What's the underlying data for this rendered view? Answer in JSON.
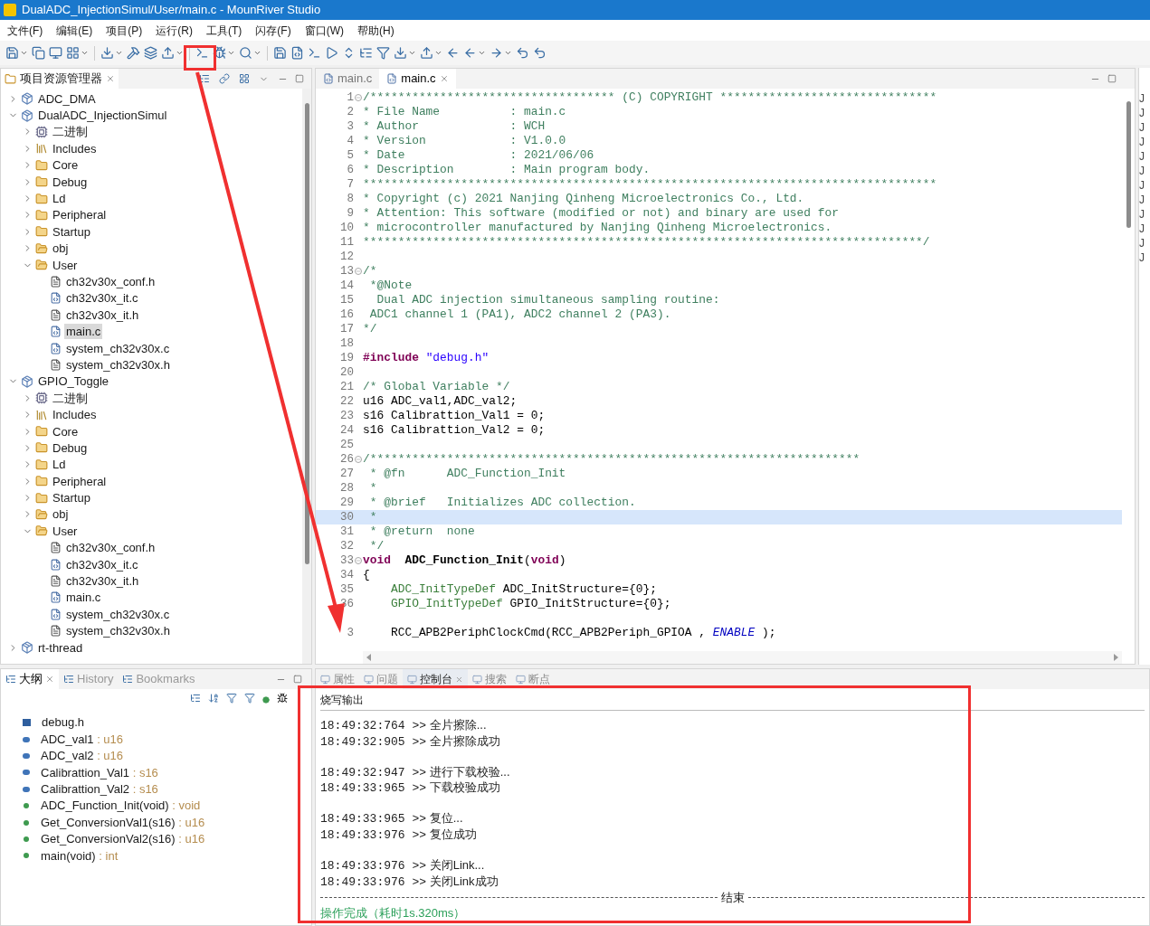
{
  "window": {
    "title": "DualADC_InjectionSimul/User/main.c - MounRiver Studio"
  },
  "menu": [
    "文件(F)",
    "编辑(E)",
    "项目(P)",
    "运行(R)",
    "工具(T)",
    "闪存(F)",
    "窗口(W)",
    "帮助(H)"
  ],
  "project_explorer": {
    "title": "项目资源管理器",
    "tree": [
      {
        "label": "ADC_DMA",
        "kind": "project",
        "expanded": false,
        "selected": false
      },
      {
        "label": "DualADC_InjectionSimul",
        "kind": "project",
        "expanded": true,
        "selected": false,
        "children": [
          {
            "label": "二进制",
            "kind": "binaries",
            "expanded": false,
            "selected": false
          },
          {
            "label": "Includes",
            "kind": "includes",
            "expanded": false,
            "selected": false
          },
          {
            "label": "Core",
            "kind": "source",
            "expanded": false,
            "selected": false
          },
          {
            "label": "Debug",
            "kind": "source",
            "expanded": false,
            "selected": false
          },
          {
            "label": "Ld",
            "kind": "source",
            "expanded": false,
            "selected": false
          },
          {
            "label": "Peripheral",
            "kind": "source",
            "expanded": false,
            "selected": false
          },
          {
            "label": "Startup",
            "kind": "source",
            "expanded": false,
            "selected": false
          },
          {
            "label": "obj",
            "kind": "folder",
            "expanded": false,
            "selected": false
          },
          {
            "label": "User",
            "kind": "folder",
            "expanded": true,
            "selected": false,
            "children": [
              {
                "label": "ch32v30x_conf.h",
                "kind": "h",
                "selected": false
              },
              {
                "label": "ch32v30x_it.c",
                "kind": "c",
                "selected": false
              },
              {
                "label": "ch32v30x_it.h",
                "kind": "h",
                "selected": false
              },
              {
                "label": "main.c",
                "kind": "c",
                "selected": true
              },
              {
                "label": "system_ch32v30x.c",
                "kind": "c",
                "selected": false
              },
              {
                "label": "system_ch32v30x.h",
                "kind": "h",
                "selected": false
              }
            ]
          }
        ]
      },
      {
        "label": "GPIO_Toggle",
        "kind": "project",
        "expanded": true,
        "selected": false,
        "children": [
          {
            "label": "二进制",
            "kind": "binaries",
            "expanded": false,
            "selected": false
          },
          {
            "label": "Includes",
            "kind": "includes",
            "expanded": false,
            "selected": false
          },
          {
            "label": "Core",
            "kind": "source",
            "expanded": false,
            "selected": false
          },
          {
            "label": "Debug",
            "kind": "source",
            "expanded": false,
            "selected": false
          },
          {
            "label": "Ld",
            "kind": "source",
            "expanded": false,
            "selected": false
          },
          {
            "label": "Peripheral",
            "kind": "source",
            "expanded": false,
            "selected": false
          },
          {
            "label": "Startup",
            "kind": "source",
            "expanded": false,
            "selected": false
          },
          {
            "label": "obj",
            "kind": "folder",
            "expanded": false,
            "selected": false
          },
          {
            "label": "User",
            "kind": "folder",
            "expanded": true,
            "selected": false,
            "children": [
              {
                "label": "ch32v30x_conf.h",
                "kind": "h",
                "selected": false
              },
              {
                "label": "ch32v30x_it.c",
                "kind": "c",
                "selected": false
              },
              {
                "label": "ch32v30x_it.h",
                "kind": "h",
                "selected": false
              },
              {
                "label": "main.c",
                "kind": "c",
                "selected": false
              },
              {
                "label": "system_ch32v30x.c",
                "kind": "c",
                "selected": false
              },
              {
                "label": "system_ch32v30x.h",
                "kind": "h",
                "selected": false
              }
            ]
          }
        ]
      },
      {
        "label": "rt-thread",
        "kind": "project",
        "expanded": false,
        "selected": false
      }
    ]
  },
  "editor": {
    "tabs": [
      {
        "label": "main.c",
        "selected": false
      },
      {
        "label": "main.c",
        "selected": true
      }
    ],
    "lines": [
      {
        "n": "1",
        "fold": true,
        "current": false,
        "segs": [
          {
            "kind": "comment",
            "s": "/*********************************** (C) COPYRIGHT *******************************"
          }
        ]
      },
      {
        "n": "2",
        "fold": false,
        "current": false,
        "segs": [
          {
            "kind": "comment",
            "s": "* File Name          : main.c"
          }
        ]
      },
      {
        "n": "3",
        "fold": false,
        "current": false,
        "segs": [
          {
            "kind": "comment",
            "s": "* Author             : WCH"
          }
        ]
      },
      {
        "n": "4",
        "fold": false,
        "current": false,
        "segs": [
          {
            "kind": "comment",
            "s": "* Version            : V1.0.0"
          }
        ]
      },
      {
        "n": "5",
        "fold": false,
        "current": false,
        "segs": [
          {
            "kind": "comment",
            "s": "* Date               : 2021/06/06"
          }
        ]
      },
      {
        "n": "6",
        "fold": false,
        "current": false,
        "segs": [
          {
            "kind": "comment",
            "s": "* Description        : Main program body."
          }
        ]
      },
      {
        "n": "7",
        "fold": false,
        "current": false,
        "segs": [
          {
            "kind": "comment",
            "s": "**********************************************************************************"
          }
        ]
      },
      {
        "n": "8",
        "fold": false,
        "current": false,
        "segs": [
          {
            "kind": "comment",
            "s": "* Copyright (c) 2021 Nanjing Qinheng Microelectronics Co., Ltd."
          }
        ]
      },
      {
        "n": "9",
        "fold": false,
        "current": false,
        "segs": [
          {
            "kind": "comment",
            "s": "* Attention: This software (modified or not) and binary are used for"
          }
        ]
      },
      {
        "n": "10",
        "fold": false,
        "current": false,
        "segs": [
          {
            "kind": "comment",
            "s": "* microcontroller manufactured by Nanjing Qinheng Microelectronics."
          }
        ]
      },
      {
        "n": "11",
        "fold": false,
        "current": false,
        "segs": [
          {
            "kind": "comment",
            "s": "********************************************************************************/"
          }
        ]
      },
      {
        "n": "12",
        "fold": false,
        "current": false
      },
      {
        "n": "13",
        "fold": true,
        "current": false,
        "segs": [
          {
            "kind": "comment",
            "s": "/*"
          }
        ]
      },
      {
        "n": "14",
        "fold": false,
        "current": false,
        "segs": [
          {
            "kind": "comment",
            "s": " *@Note"
          }
        ]
      },
      {
        "n": "15",
        "fold": false,
        "current": false,
        "segs": [
          {
            "kind": "comment",
            "s": "  Dual ADC injection simultaneous sampling routine:"
          }
        ]
      },
      {
        "n": "16",
        "fold": false,
        "current": false,
        "segs": [
          {
            "kind": "comment",
            "s": " ADC1 channel 1 (PA1), ADC2 channel 2 (PA3)."
          }
        ]
      },
      {
        "n": "17",
        "fold": false,
        "current": false,
        "segs": [
          {
            "kind": "comment",
            "s": "*/"
          }
        ]
      },
      {
        "n": "18",
        "fold": false,
        "current": false
      },
      {
        "n": "19",
        "fold": false,
        "current": false,
        "segs": [
          {
            "kind": "keyword",
            "s": "#include"
          },
          {
            "kind": "string",
            "s": " \"debug.h\""
          }
        ]
      },
      {
        "n": "20",
        "fold": false,
        "current": false
      },
      {
        "n": "21",
        "fold": false,
        "current": false,
        "segs": [
          {
            "kind": "comment",
            "s": "/* Global Variable */"
          }
        ]
      },
      {
        "n": "22",
        "fold": false,
        "current": false,
        "segs": [
          {
            "kind": "plain",
            "s": "u16 ADC_val1,ADC_val2;"
          }
        ]
      },
      {
        "n": "23",
        "fold": false,
        "current": false,
        "segs": [
          {
            "kind": "plain",
            "s": "s16 Calibrattion_Val1 = 0;"
          }
        ]
      },
      {
        "n": "24",
        "fold": false,
        "current": false,
        "segs": [
          {
            "kind": "plain",
            "s": "s16 Calibrattion_Val2 = 0;"
          }
        ]
      },
      {
        "n": "25",
        "fold": false,
        "current": false
      },
      {
        "n": "26",
        "fold": true,
        "current": false,
        "segs": [
          {
            "kind": "comment",
            "s": "/**********************************************************************"
          }
        ]
      },
      {
        "n": "27",
        "fold": false,
        "current": false,
        "segs": [
          {
            "kind": "comment",
            "s": " * @fn      ADC_Function_Init"
          }
        ]
      },
      {
        "n": "28",
        "fold": false,
        "current": false,
        "segs": [
          {
            "kind": "comment",
            "s": " *"
          }
        ]
      },
      {
        "n": "29",
        "fold": false,
        "current": false,
        "segs": [
          {
            "kind": "comment",
            "s": " * @brief   Initializes ADC collection."
          }
        ]
      },
      {
        "n": "30",
        "fold": false,
        "current": true,
        "segs": [
          {
            "kind": "comment",
            "s": " *"
          }
        ]
      },
      {
        "n": "31",
        "fold": false,
        "current": false,
        "segs": [
          {
            "kind": "comment",
            "s": " * @return  none"
          }
        ]
      },
      {
        "n": "32",
        "fold": false,
        "current": false,
        "segs": [
          {
            "kind": "comment",
            "s": " */"
          }
        ]
      },
      {
        "n": "33",
        "fold": true,
        "current": false,
        "segs": [
          {
            "kind": "keyword",
            "s": "void"
          },
          {
            "kind": "function",
            "s": "  ADC_Function_Init"
          },
          {
            "kind": "plain",
            "s": "("
          },
          {
            "kind": "keyword",
            "s": "void"
          },
          {
            "kind": "plain",
            "s": ")"
          }
        ]
      },
      {
        "n": "34",
        "fold": false,
        "current": false,
        "segs": [
          {
            "kind": "plain",
            "s": "{"
          }
        ]
      },
      {
        "n": "35",
        "fold": false,
        "current": false,
        "segs": [
          {
            "kind": "type",
            "s": "    ADC_InitTypeDef"
          },
          {
            "kind": "plain",
            "s": " ADC_InitStructure={0};"
          }
        ]
      },
      {
        "n": "36",
        "fold": false,
        "current": false,
        "segs": [
          {
            "kind": "type",
            "s": "    GPIO_InitTypeDef"
          },
          {
            "kind": "plain",
            "s": " GPIO_InitStructure={0};"
          }
        ]
      },
      {
        "fold": false,
        "current": false
      },
      {
        "n": "3",
        "fold": false,
        "current": false,
        "segs": [
          {
            "kind": "plain",
            "s": "    RCC_APB2PeriphClockCmd(RCC_APB2Periph_GPIOA , "
          },
          {
            "kind": "macro",
            "s": "ENABLE"
          },
          {
            "kind": "plain",
            "s": " );"
          }
        ]
      }
    ]
  },
  "right_strip": [
    "J",
    "J",
    "J",
    "J",
    "J",
    "J",
    "J",
    "J",
    "J",
    "J",
    "J",
    "J"
  ],
  "outline": {
    "tabs": [
      {
        "label": "大纲",
        "selected": true
      },
      {
        "label": "History",
        "selected": false
      },
      {
        "label": "Bookmarks",
        "selected": false
      }
    ],
    "items": [
      {
        "kind": "include",
        "name": "debug.h"
      },
      {
        "kind": "variable",
        "name": "ADC_val1",
        "type": " : u16"
      },
      {
        "kind": "variable",
        "name": "ADC_val2",
        "type": " : u16"
      },
      {
        "kind": "variable",
        "name": "Calibrattion_Val1",
        "type": " : s16"
      },
      {
        "kind": "variable",
        "name": "Calibrattion_Val2",
        "type": " : s16"
      },
      {
        "kind": "function",
        "name": "ADC_Function_Init(void)",
        "type": " : void"
      },
      {
        "kind": "function",
        "name": "Get_ConversionVal1(s16)",
        "type": " : u16"
      },
      {
        "kind": "function",
        "name": "Get_ConversionVal2(s16)",
        "type": " : u16"
      },
      {
        "kind": "function",
        "name": "main(void)",
        "type": " : int"
      }
    ]
  },
  "console": {
    "tabs": [
      {
        "label": "属性",
        "selected": false
      },
      {
        "label": "问题",
        "selected": false
      },
      {
        "label": "控制台",
        "selected": true
      },
      {
        "label": "搜索",
        "selected": false
      },
      {
        "label": "断点",
        "selected": false
      }
    ],
    "title": "烧写输出",
    "groups": [
      [
        {
          "time": "18:49:32:764 >>",
          "msg": "全片擦除..."
        },
        {
          "time": "18:49:32:905 >>",
          "msg": "全片擦除成功"
        }
      ],
      [
        {
          "time": "18:49:32:947 >>",
          "msg": "进行下载校验..."
        },
        {
          "time": "18:49:33:965 >>",
          "msg": "下载校验成功"
        }
      ],
      [
        {
          "time": "18:49:33:965 >>",
          "msg": "复位..."
        },
        {
          "time": "18:49:33:976 >>",
          "msg": "复位成功"
        }
      ],
      [
        {
          "time": "18:49:33:976 >>",
          "msg": "关闭Link..."
        },
        {
          "time": "18:49:33:976 >>",
          "msg": "关闭Link成功"
        }
      ]
    ],
    "end_label": "结束",
    "done": "操作完成（耗时1s.320ms）"
  }
}
